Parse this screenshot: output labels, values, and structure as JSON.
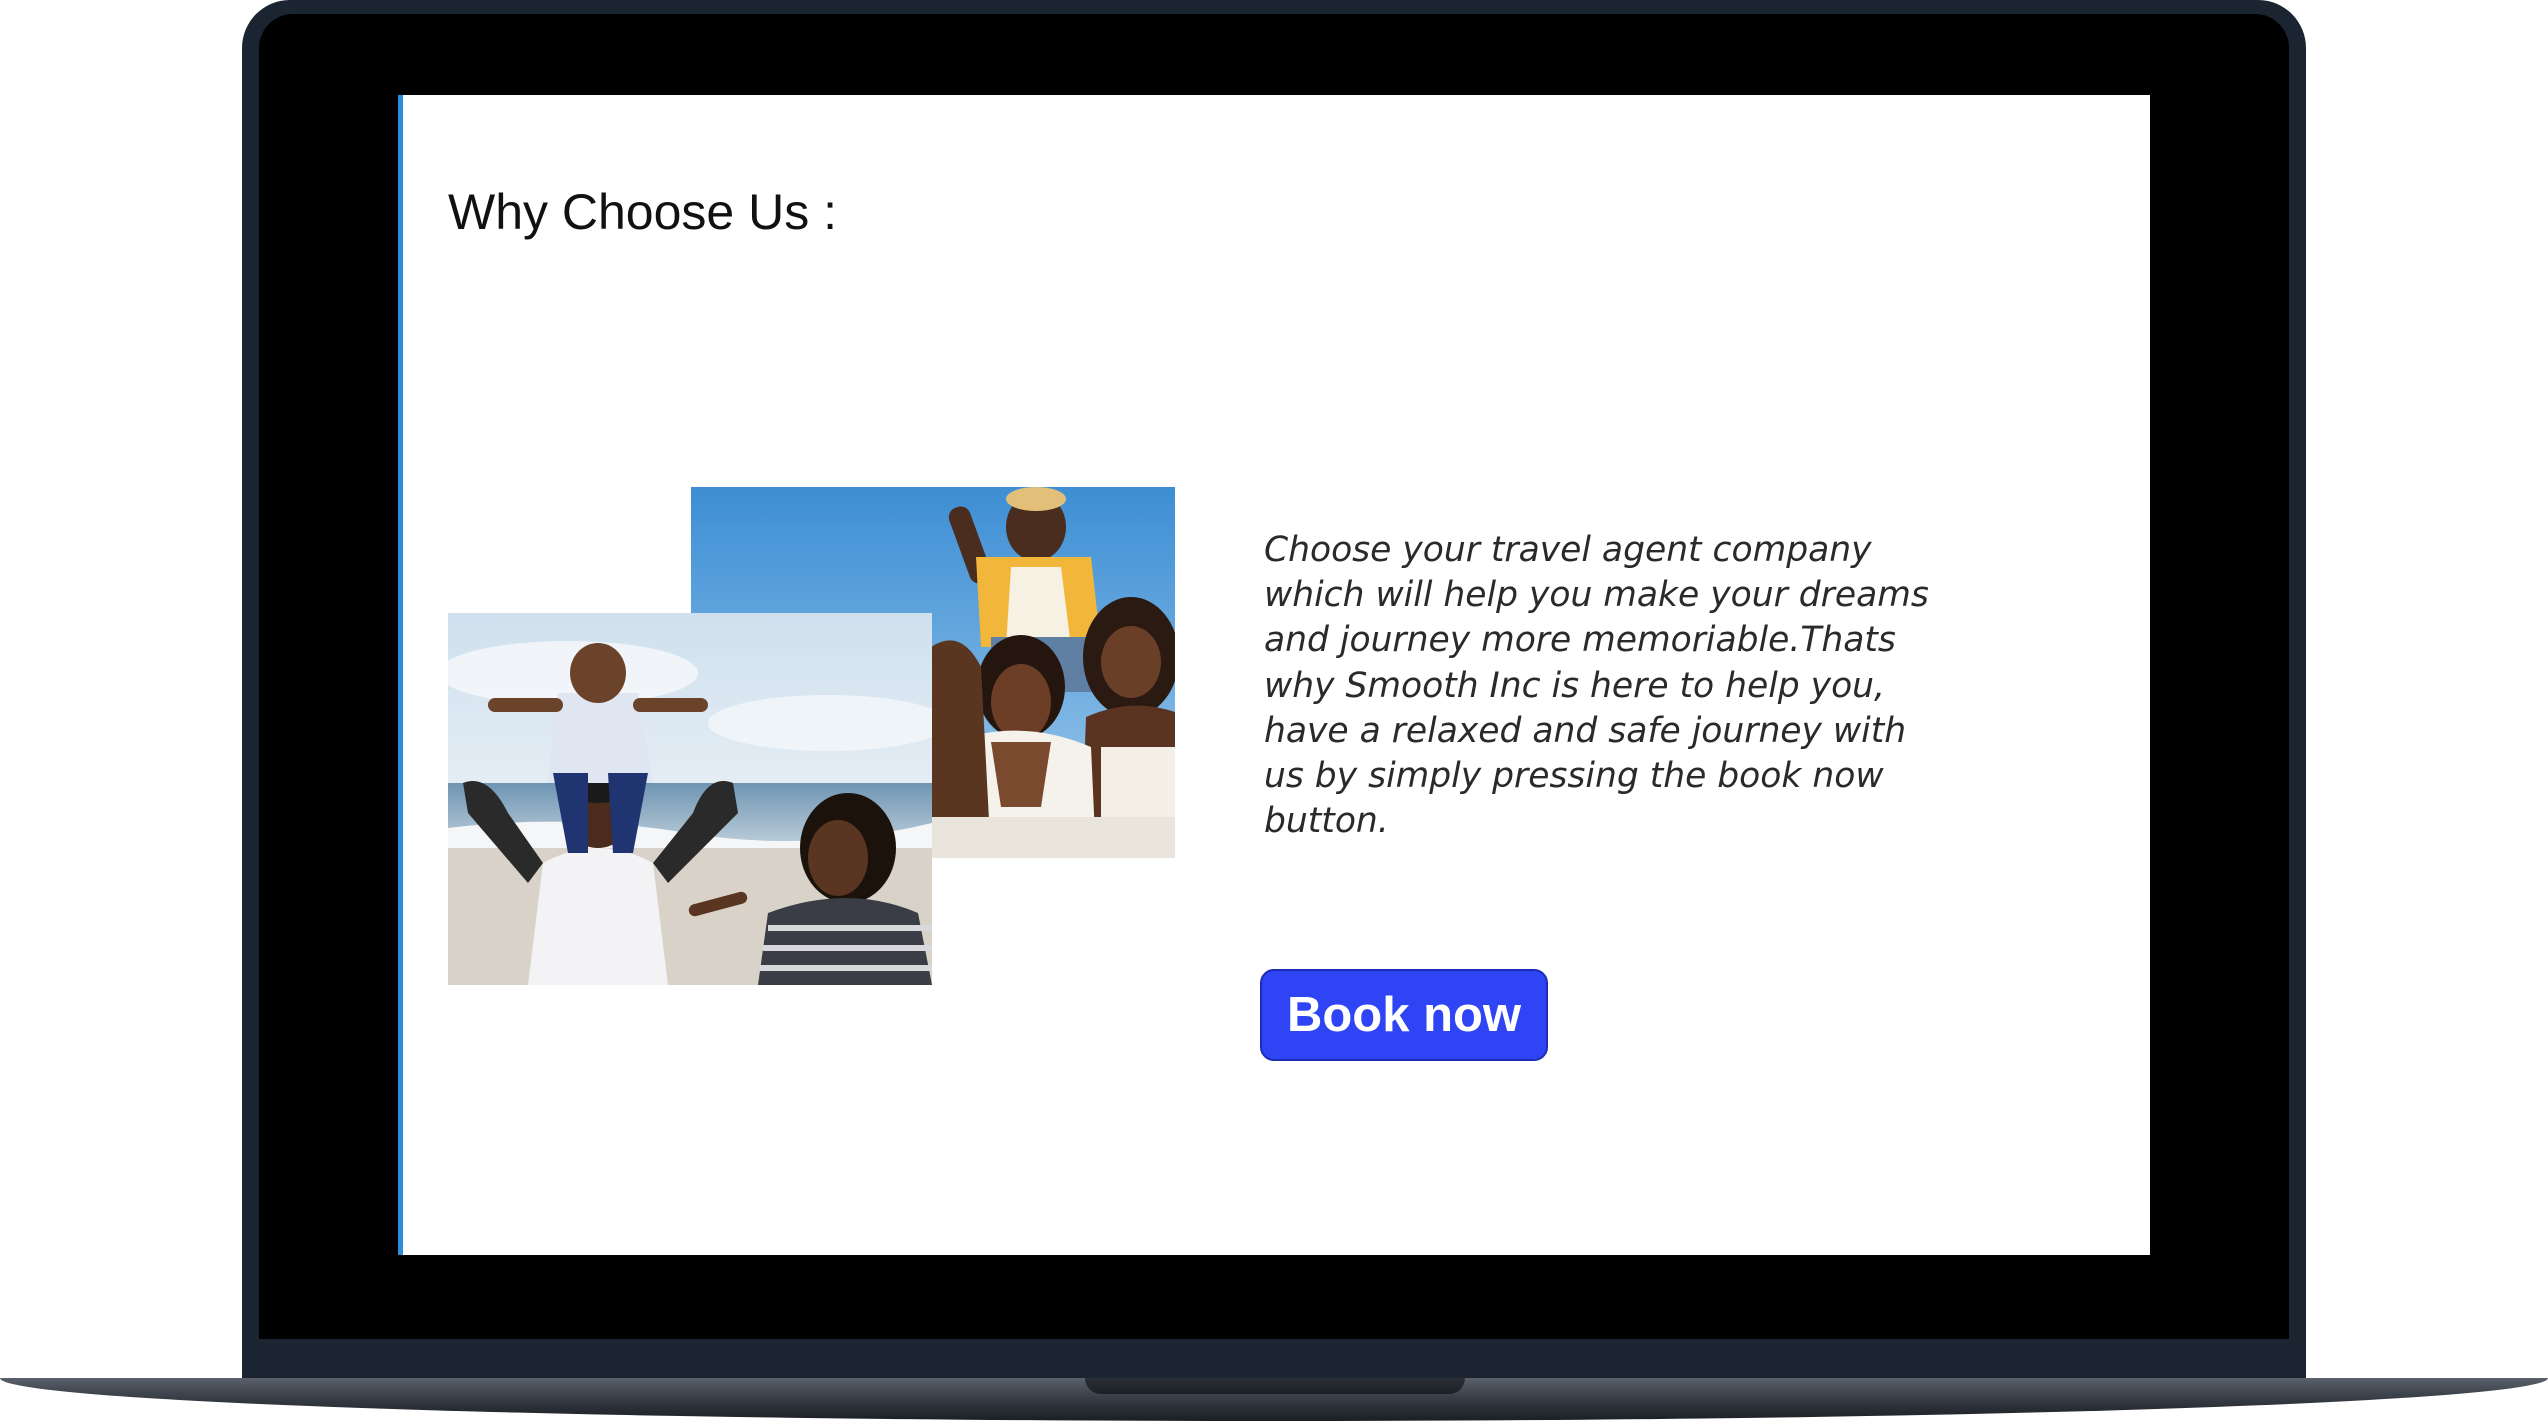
{
  "section": {
    "heading": "Why Choose Us :"
  },
  "content": {
    "description": "Choose your travel agent company which will help you make your dreams and journey more memoriable.Thats why Smooth Inc is here to help you, have a relaxed and safe journey with us by simply pressing the book now button.",
    "book_button_label": "Book now"
  },
  "photos": {
    "group": "group-of-friends-photo",
    "family": "family-on-beach-photo"
  },
  "colors": {
    "button_bg": "#2f45f5",
    "screen_accent": "#2d8fdc",
    "laptop_frame": "#1b2431",
    "bezel": "#000000"
  }
}
